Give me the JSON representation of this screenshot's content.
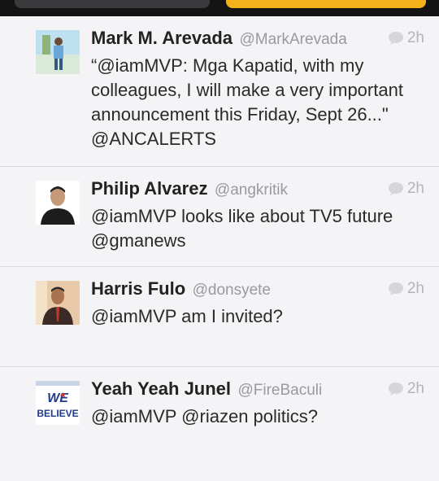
{
  "tweets": [
    {
      "name": "Mark M. Arevada",
      "handle": "@MarkArevada",
      "time": "2h",
      "text": "“@iamMVP: Mga Kapatid, with my colleagues, I will make a very important announcement this Friday, Sept 26...\" @ANCALERTS"
    },
    {
      "name": "Philip Alvarez",
      "handle": "@angkritik",
      "time": "2h",
      "text": "@iamMVP looks like about TV5 future @gmanews"
    },
    {
      "name": "Harris Fulo",
      "handle": "@donsyete",
      "time": "2h",
      "text": "@iamMVP am I invited?"
    },
    {
      "name": "Yeah Yeah Junel",
      "handle": "@FireBaculi",
      "time": "2h",
      "text": "@iamMVP @riazen politics?",
      "avatar_text": [
        "WE",
        "BELIEVE"
      ]
    }
  ],
  "colors": {
    "background": "#f2f2f4",
    "topbar": "#141414",
    "accent": "#f4b21a",
    "timestamp": "#b4b4b8"
  }
}
